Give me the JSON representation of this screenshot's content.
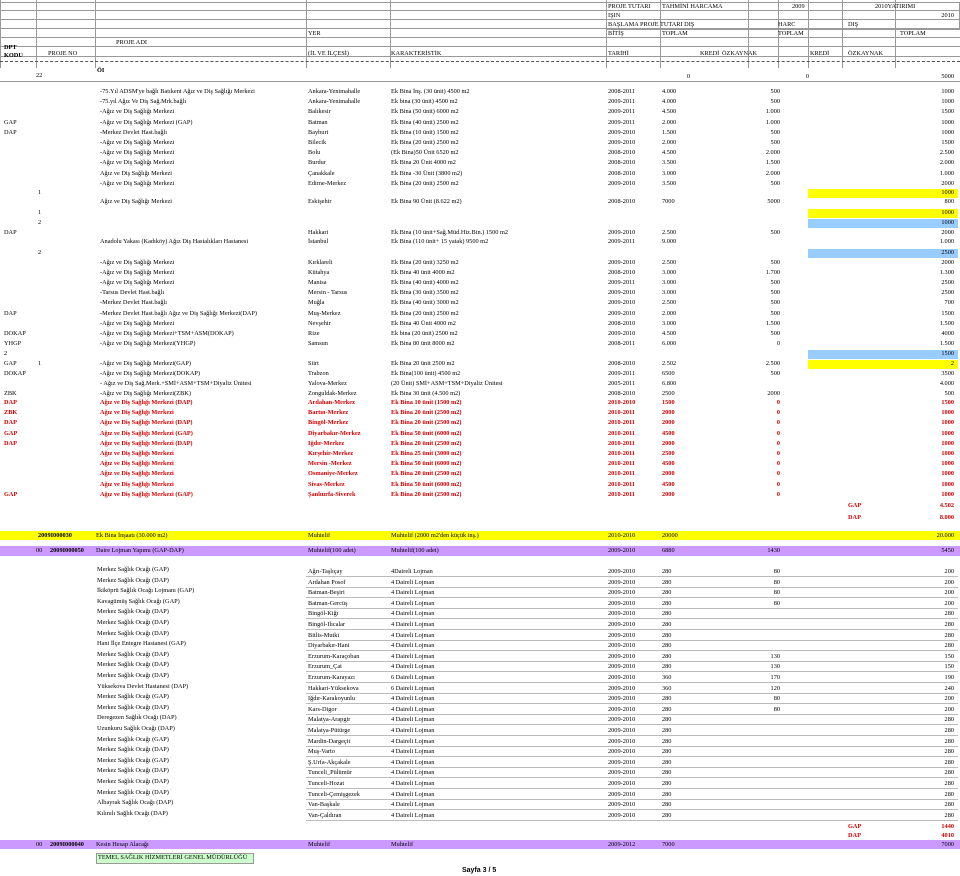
{
  "header": {
    "dpt_kodu": "DPT\nKODU",
    "proje_no": "PROJE NO",
    "proje_adi": "PROJE ADI",
    "yer": "YER",
    "il_ilcesi": "(İL VE İLÇESİ)",
    "karakteristik": "KARAKTERİSTİK",
    "proje_tutari": "PROJE TUTARI",
    "tahmini_harcama": "TAHMİNİ HARCAMA",
    "year_2009": "2009",
    "yatirimi_2010": "2010YATIRIMI",
    "isin": "IŞIN",
    "baslama": "BAŞLAMA",
    "bitis": "BİTİŞ",
    "proje_tutari_dis": "PROJE TUTARI DIŞ",
    "harc": "HARC",
    "dis": "DIŞ",
    "toplam": "TOPLAM",
    "toplam2": "TOPLAM",
    "toplam3": "TOPLAM",
    "tarihi": "TARİHİ",
    "kredi": "KREDİ",
    "ozkaynak": "ÖZKAYNAK",
    "kredi2": "KREDİ",
    "ozkaynak2": "ÖZKAYNAK",
    "year_right": "2010"
  },
  "top_row": {
    "no": "22",
    "name": "ÖI",
    "v1": "0",
    "v2": "0",
    "v3": "5000"
  },
  "rows": [
    {
      "code": "",
      "name": "-75.Yıl ADSM'ye bağlı Batıkent Ağız ve Diş Sağlığı Merkezi",
      "yer": "Ankara-Yenimahalle",
      "kar": "Ek Bina İnş. (30 ünit) 4500 m2",
      "tar": "2008-2011",
      "pt": "4.000",
      "kredi": "500",
      "top": "1000"
    },
    {
      "code": "",
      "name": "-75.yıl Ağız Ve Diş Sağ.Mrk.bağlı",
      "yer": "Ankara-Yenimahalle",
      "kar": "Ek bina (30 ünit) 4500 m2",
      "tar": "2009-2011",
      "pt": "4.000",
      "kredi": "500",
      "top": "1000"
    },
    {
      "code": "",
      "name": "-Ağız ve Diş Sağlığı Merkezi",
      "yer": "Balıkesir",
      "kar": "Ek Bina (50 ünit) 6000 m2",
      "tar": "2009-2011",
      "pt": "4.500",
      "kredi": "1.000",
      "top": "1500"
    },
    {
      "code": "GAP",
      "name": "-Ağız ve Diş Sağlığı Merkezi (GAP)",
      "yer": "Batman",
      "kar": "Ek Bina (40 ünit) 2500 m2",
      "tar": "2009-2011",
      "pt": "2.000",
      "kredi": "1.000",
      "top": "1000"
    },
    {
      "code": "DAP",
      "name": "-Merkez Devlet Hast.bağlı",
      "yer": "Bayburt",
      "kar": "Ek Bina (10 ünit) 1500 m2",
      "tar": "2009-2010",
      "pt": "1.500",
      "kredi": "500",
      "top": "1000"
    },
    {
      "code": "",
      "name": "-Ağız ve Diş Sağlığı Merkezi",
      "yer": "Bilecik",
      "kar": "Ek Bina (20 ünit) 2500 m2",
      "tar": "2009-2010",
      "pt": "2.000",
      "kredi": "500",
      "top": "1500"
    },
    {
      "code": "",
      "name": "-Ağız ve Diş Sağlığı Merkezi",
      "yer": "Bolu",
      "kar": "(Ek Bina)50 Ünit 6520 m2",
      "tar": "2008-2010",
      "pt": "4.500",
      "kredi": "2.000",
      "top": "2.500"
    },
    {
      "code": "",
      "name": "-Ağız ve Diş Sağlığı Merkezi",
      "yer": "Burdur",
      "kar": "Ek Bina 20 Ünit 4000 m2",
      "tar": "2008-2010",
      "pt": "3.500",
      "kredi": "1.500",
      "top": "2.000"
    },
    {
      "code": "",
      "name": "Ağız ve Diş Sağlığı Merkezi",
      "yer": "Çanakkale",
      "kar": "Ek Bina -30 Ünit (3800 m2)",
      "tar": "2008-2010",
      "pt": "3.000",
      "kredi": "2.000",
      "top": "1.000"
    },
    {
      "code": "",
      "name": "-Ağız ve Diş Sağlığı Merkezi",
      "yer": "Edirne-Merkez",
      "kar": "Ek Bina (20 ünit) 2500 m2",
      "tar": "2009-2010",
      "pt": "3.500",
      "kredi": "500",
      "top": "2000"
    }
  ],
  "mid_rows": [
    {
      "code": "1",
      "top": "1000",
      "color": "#ffff00"
    },
    {
      "code": "",
      "name": "Ağız ve Diş Sağlığı Merkezi",
      "yer": "Eskişehir",
      "kar": "Ek Bina 90 Ünit (8.622 m2)",
      "tar": "2008-2010",
      "pt": "7000",
      "kredi": "5000",
      "top": "800"
    },
    {
      "code": "1",
      "top": "1000",
      "color": "#ffff00"
    },
    {
      "code": "2",
      "top": "1000",
      "color": "#99ccff"
    },
    {
      "code": "DAP",
      "name": "",
      "yer": "Hakkari",
      "kar": "Ek Bina (10 ünit+Sağ.Müd.Hiz.Bin.) 1500 m2",
      "tar": "2009-2010",
      "pt": "2.500",
      "kredi": "500",
      "top": "2000"
    },
    {
      "code": "",
      "name": "Anadolu Yakası (Kadıköy) Ağız Diş Hastalıkları Hastanesi",
      "yer": "İstanbul",
      "kar": "Ek Bina (110 ünit+ 15 yatak) 9500 m2",
      "tar": "2009-2011",
      "pt": "9.000",
      "kredi": "",
      "top": "1.000"
    },
    {
      "code": "2",
      "top": "2500",
      "color": "#99ccff"
    }
  ],
  "rows2": [
    {
      "code": "",
      "name": "-Ağız ve Diş Sağlığı Merkezi",
      "yer": "Kırklareli",
      "kar": "Ek Bina (20 ünit) 3250 m2",
      "tar": "2009-2010",
      "pt": "2.500",
      "kredi": "500",
      "top": "2000"
    },
    {
      "code": "",
      "name": "-Ağız ve Diş Sağlığı Merkezi",
      "yer": "Kütahya",
      "kar": "Ek Bina 40 ünit 4000 m2",
      "tar": "2008-2010",
      "pt": "3.000",
      "kredi": "1.700",
      "top": "1.300"
    },
    {
      "code": "",
      "name": "-Ağız ve Diş Sağlığı Merkezi",
      "yer": "Manisa",
      "kar": "Ek Bina (40 ünit) 4000 m2",
      "tar": "2009-2011",
      "pt": "3.000",
      "kredi": "500",
      "top": "2500"
    },
    {
      "code": "",
      "name": "-Tarsus Devlet Hast.bağlı",
      "yer": "Mersin - Tarsus",
      "kar": "Ek Bina (30 ünit) 3500 m2",
      "tar": "2009-2010",
      "pt": "3.000",
      "kredi": "500",
      "top": "2500"
    },
    {
      "code": "",
      "name": "-Merkez Devlet Hast.bağlı",
      "yer": "Muğla",
      "kar": "Ek Bina (40 ünit) 3000 m2",
      "tar": "2009-2010",
      "pt": "2.500",
      "kredi": "500",
      "top": "700"
    },
    {
      "code": "DAP",
      "name": "-Merkez Devlet Hast.bağlı Ağız ve Diş Sağlığı Merkezi(DAP)",
      "yer": "Muş-Merkez",
      "kar": "Ek Bina (20 ünit) 2500 m2",
      "tar": "2009-2010",
      "pt": "2.000",
      "kredi": "500",
      "top": "1500"
    },
    {
      "code": "",
      "name": "-Ağız ve Diş Sağlığı Merkezi",
      "yer": "Nevşehir",
      "kar": "Ek Bina 40 Ünit 4000 m2",
      "tar": "2008-2010",
      "pt": "3.000",
      "kredi": "1.500",
      "top": "1.500"
    },
    {
      "code": "DOKAP",
      "name": "-Ağız ve Diş Sağlığı Merkezi+TSM+ASM(DOKAP)",
      "yer": "Rize",
      "kar": "Ek bina (20 ünit) 2500 m2",
      "tar": "2009-2010",
      "pt": "4.500",
      "kredi": "500",
      "top": "4000"
    },
    {
      "code": "YHGP",
      "name": "-Ağız ve Diş Sağlığı Merkezi(YHGP)",
      "yer": "Samsun",
      "kar": "Ek Bina 80 ünit 8000 m2",
      "tar": "2008-2011",
      "pt": "6.000",
      "kredi": "0",
      "top": "1.500"
    },
    {
      "code": "2",
      "name": "",
      "yer": "",
      "kar": "",
      "tar": "",
      "pt": "",
      "kredi": "",
      "top": "1500",
      "color": "#99ccff"
    },
    {
      "code": "GAP",
      "no": "1",
      "name": "-Ağız ve Diş Sağlığı Merkezi(GAP)",
      "yer": "Siirt",
      "kar": "Ek Bina 20 ünit 2500 m2",
      "tar": "2008-2010",
      "pt": "2.502",
      "kredi": "2.500",
      "top": "2",
      "color": "#ffff00"
    },
    {
      "code": "DOKAP",
      "name": "-Ağız ve Diş Sağlığı Merkezi(DOKAP)",
      "yer": "Trabzon",
      "kar": "Ek Bina(100 ünit) 4500 m2",
      "tar": "2009-2011",
      "pt": "6500",
      "kredi": "500",
      "top": "3500"
    },
    {
      "code": "",
      "name": "- Ağız ve Diş Sağ.Merk.+SMİ+ASM+TSM+Diyaliz Ünitesi",
      "yer": "Yalova-Merkez",
      "kar": "(20 Ünit) SMİ+ASM+TSM+Diyaliz Ünitesi",
      "tar": "2005-2011",
      "pt": "6.800",
      "kredi": "",
      "top": "4.000"
    },
    {
      "code": "ZBK",
      "name": "-Ağız ve Diş Sağlığı Merkezi(ZBK)",
      "yer": "Zonguldak-Merkez",
      "kar": "Ek Bina 30 ünit (4.500 m2)",
      "tar": "2008-2010",
      "pt": "2500",
      "kredi": "2000",
      "top": "500"
    }
  ],
  "red_rows": [
    {
      "code": "DAP",
      "name": "Ağız ve Diş Sağlığı Merkezi (DAP)",
      "yer": "Ardahan-Merkez",
      "kar": "Ek Bina 10 ünit (1500 m2)",
      "tar": "2010-2010",
      "pt": "1500",
      "kredi": "0",
      "top": "1500"
    },
    {
      "code": "ZBK",
      "name": "Ağız ve Diş Sağlığı Merkezi",
      "yer": "Bartın-Merkez",
      "kar": "Ek Bina 20 ünit (2500 m2)",
      "tar": "2010-2011",
      "pt": "2000",
      "kredi": "0",
      "top": "1000"
    },
    {
      "code": "DAP",
      "name": "Ağız ve Diş Sağlığı Merkezi (DAP)",
      "yer": "Bingöl-Merkez",
      "kar": "Ek Bina 20 ünit (2500 m2)",
      "tar": "2010-2011",
      "pt": "2000",
      "kredi": "0",
      "top": "1000"
    },
    {
      "code": "GAP",
      "name": "Ağız ve Diş Sağlığı Merkezi (GAP)",
      "yer": "Diyarbakır-Merkez",
      "kar": "Ek Bina 50 ünit (6000 m2)",
      "tar": "2010-2011",
      "pt": "4500",
      "kredi": "0",
      "top": "1000"
    },
    {
      "code": "DAP",
      "name": "Ağız ve Diş Sağlığı Merkezi (DAP)",
      "yer": "Iğdır-Merkez",
      "kar": "Ek Bina 20 ünit (2500 m2)",
      "tar": "2010-2011",
      "pt": "2000",
      "kredi": "0",
      "top": "1000"
    },
    {
      "code": "",
      "name": "Ağız ve Diş Sağlığı Merkezi",
      "yer": "Kırşehir-Merkez",
      "kar": "Ek Bina 25 ünit (3000 m2)",
      "tar": "2010-2011",
      "pt": "2500",
      "kredi": "0",
      "top": "1000"
    },
    {
      "code": "",
      "name": "Ağız ve Diş Sağlığı Merkezi",
      "yer": "Mersin -Merkez",
      "kar": "Ek Bina 50 ünit (6000 m2)",
      "tar": "2010-2011",
      "pt": "4500",
      "kredi": "0",
      "top": "1000"
    },
    {
      "code": "",
      "name": "Ağız ve Diş Sağlığı Merkezi",
      "yer": "Osmaniye-Merkez",
      "kar": "Ek Bina 20 ünit (2500 m2)",
      "tar": "2010-2011",
      "pt": "2000",
      "kredi": "0",
      "top": "1000"
    },
    {
      "code": "",
      "name": "Ağız ve Diş Sağlığı Merkezi",
      "yer": "Sivas-Merkez",
      "kar": "Ek Bina 50 ünit (6000 m2)",
      "tar": "2010-2011",
      "pt": "4500",
      "kredi": "0",
      "top": "1000"
    },
    {
      "code": "GAP",
      "name": "Ağız ve Diş Sağlığı Merkezi (GAP)",
      "yer": "Şanlıurfa-Siverek",
      "kar": "Ek Bina 20 ünit (2500 m2)",
      "tar": "2010-2011",
      "pt": "2000",
      "kredi": "0",
      "top": "1000"
    }
  ],
  "summary1": [
    {
      "label": "GAP",
      "value": "4.502"
    },
    {
      "label": "DAP",
      "value": "8.000"
    }
  ],
  "band1": {
    "no": "2009I000030",
    "name": "Ek Bina İnşaatı (30.000 m2)",
    "yer": "Muhtelif",
    "kar": "Muhtelif (2000 m2'den küçük inş.)",
    "tar": "2010-2010",
    "pt": "20000",
    "top": "20.000",
    "color": "#ffff00"
  },
  "band2": {
    "pre": "00",
    "no": "2009I000050",
    "name": "Daire Lojman Yapımı (GAP-DAP)",
    "yer": "Muhtelif(100 adet)",
    "kar": "Muhtelif(100 adet)",
    "tar": "2009-2010",
    "pt": "6880",
    "kredi": "1430",
    "top": "5450",
    "color": "#cc99ff"
  },
  "lojman": [
    {
      "name": "Merkez Sağlık Ocağı (GAP)",
      "yer": "Ağrı-Taşlıçay",
      "kar": "4Daireli Lojman",
      "tar": "2009-2010",
      "pt": "280",
      "kredi": "80",
      "top": "200"
    },
    {
      "name": "Merkez Sağlık Ocağı (DAP)",
      "yer": "Ardahan Posof",
      "kar": "4 Daireli Lojman",
      "tar": "2009-2010",
      "pt": "280",
      "kredi": "80",
      "top": "200"
    },
    {
      "name": "İkiköprü Sağlık Ocağı Lojmanı (GAP)",
      "yer": "Batman-Beşiri",
      "kar": "4 Daireli Lojman",
      "tar": "2009-2010",
      "pt": "280",
      "kredi": "80",
      "top": "200"
    },
    {
      "name": "Kavagümüş Sağlık Ocağı (GAP)",
      "yer": "Batman-Gercüş",
      "kar": "4 Daireli Lojman",
      "tar": "2009-2010",
      "pt": "280",
      "kredi": "80",
      "top": "200"
    },
    {
      "name": "Merkez Sağlık Ocağı (DAP)",
      "yer": "Bingöl-Kiğı",
      "kar": "4 Daireli Lojman",
      "tar": "2009-2010",
      "pt": "280",
      "kredi": "",
      "top": "280"
    },
    {
      "name": "Merkez Sağlık Ocağı (DAP)",
      "yer": "Bingöl-Ilıcalar",
      "kar": "4 Daireli Lojman",
      "tar": "2009-2010",
      "pt": "280",
      "kredi": "",
      "top": "280"
    },
    {
      "name": "Merkez Sağlık Ocağı (DAP)",
      "yer": "Bitlis-Mutki",
      "kar": "4 Daireli Lojman",
      "tar": "2009-2010",
      "pt": "280",
      "kredi": "",
      "top": "280"
    },
    {
      "name": "Hani İlçe Entegre Hastanesi (GAP)",
      "yer": "Diyarbakır-Hani",
      "kar": "4 Daireli Lojman",
      "tar": "2009-2010",
      "pt": "280",
      "kredi": "",
      "top": "280"
    },
    {
      "name": "Merkez Sağlık Ocağı (DAP)",
      "yer": "Erzurum-Karaçoban",
      "kar": "4 Daireli Lojman",
      "tar": "2009-2010",
      "pt": "280",
      "kredi": "130",
      "top": "150"
    },
    {
      "name": "Merkez Sağlık Ocağı (DAP)",
      "yer": "Erzurum_Çat",
      "kar": "4 Daireli Lojman",
      "tar": "2009-2010",
      "pt": "280",
      "kredi": "130",
      "top": "150"
    },
    {
      "name": "Merkez Sağlık Ocağı (DAP)",
      "yer": "Erzurum-Karayazı",
      "kar": "6 Daireli Lojman",
      "tar": "2009-2010",
      "pt": "360",
      "kredi": "170",
      "top": "190"
    },
    {
      "name": "Yüksekova Devlet Hastanesi (DAP)",
      "yer": "Hakkari-Yüksekova",
      "kar": "6 Daireli Lojman",
      "tar": "2009-2010",
      "pt": "360",
      "kredi": "120",
      "top": "240"
    },
    {
      "name": "Merkez Sağlık Ocağı (GAP)",
      "yer": "Iğdır-Karakoyunlu",
      "kar": "4 Daireli Lojman",
      "tar": "2009-2010",
      "pt": "280",
      "kredi": "80",
      "top": "200"
    },
    {
      "name": "Merkez Sağlık Ocağı (DAP)",
      "yer": "Kars-Digor",
      "kar": "4 Daireli Lojman",
      "tar": "2009-2010",
      "pt": "280",
      "kredi": "80",
      "top": "200"
    },
    {
      "name": "Deregezen Sağlık Ocağı (DAP)",
      "yer": "Malatya-Arapgir",
      "kar": "4 Daireli Lojman",
      "tar": "2009-2010",
      "pt": "280",
      "kredi": "",
      "top": "280"
    },
    {
      "name": "Uzunkuru Sağlık Ocağı (DAP)",
      "yer": "Malatya-Pütürge",
      "kar": "4 Daireli Lojman",
      "tar": "2009-2010",
      "pt": "280",
      "kredi": "",
      "top": "280"
    },
    {
      "name": "Merkez Sağlık Ocağı (GAP)",
      "yer": "Mardin-Dargeçit",
      "kar": "4 Daireli Lojman",
      "tar": "2009-2010",
      "pt": "280",
      "kredi": "",
      "top": "280"
    },
    {
      "name": "Merkez Sağlık Ocağı (DAP)",
      "yer": "Muş-Varto",
      "kar": "4 Daireli Lojman",
      "tar": "2009-2010",
      "pt": "280",
      "kredi": "",
      "top": "280"
    },
    {
      "name": "Merkez Sağlık Ocağı (GAP)",
      "yer": "Ş.Urfa-Akçakale",
      "kar": "4 Daireli Lojman",
      "tar": "2009-2010",
      "pt": "280",
      "kredi": "",
      "top": "280"
    },
    {
      "name": "Merkez Sağlık Ocağı (DAP)",
      "yer": "Tunceli_Pülümür",
      "kar": "4 Daireli Lojman",
      "tar": "2009-2010",
      "pt": "280",
      "kredi": "",
      "top": "280"
    },
    {
      "name": "Merkez Sağlık Ocağı (DAP)",
      "yer": "Tunceli-Hozat",
      "kar": "4 Daireli Lojman",
      "tar": "2009-2010",
      "pt": "280",
      "kredi": "",
      "top": "280"
    },
    {
      "name": "Merkez Sağlık Ocağı (DAP)",
      "yer": "Tunceli-Çemişgezek",
      "kar": "4 Daireli Lojman",
      "tar": "2009-2010",
      "pt": "280",
      "kredi": "",
      "top": "280"
    },
    {
      "name": "Albayrak Sağlık Ocağı (DAP)",
      "yer": "Van-Başkale",
      "kar": "4 Daireli Lojman",
      "tar": "2009-2010",
      "pt": "280",
      "kredi": "",
      "top": "280"
    },
    {
      "name": "Kılınılı Sağlık Ocağı (DAP)",
      "yer": "Van-Çaldıran",
      "kar": "4 Daireli Lojman",
      "tar": "2009-2010",
      "pt": "280",
      "kredi": "",
      "top": "280"
    }
  ],
  "summary2": [
    {
      "label": "GAP",
      "value": "1440"
    },
    {
      "label": "DAP",
      "value": "4010"
    }
  ],
  "band3": {
    "pre": "00",
    "no": "2009I000040",
    "name": "Kesin Hesap Alacağı",
    "yer": "Muhtelif",
    "kar": "Muhtelif",
    "tar": "2009-2012",
    "pt": "7000",
    "top": "7000",
    "color": "#cc99ff"
  },
  "footer_label": "TEMEL SAĞLIK HİZMETLERİ GENEL MÜDÜRLÜĞÜ",
  "page_label": "Sayfa 3 / 5"
}
